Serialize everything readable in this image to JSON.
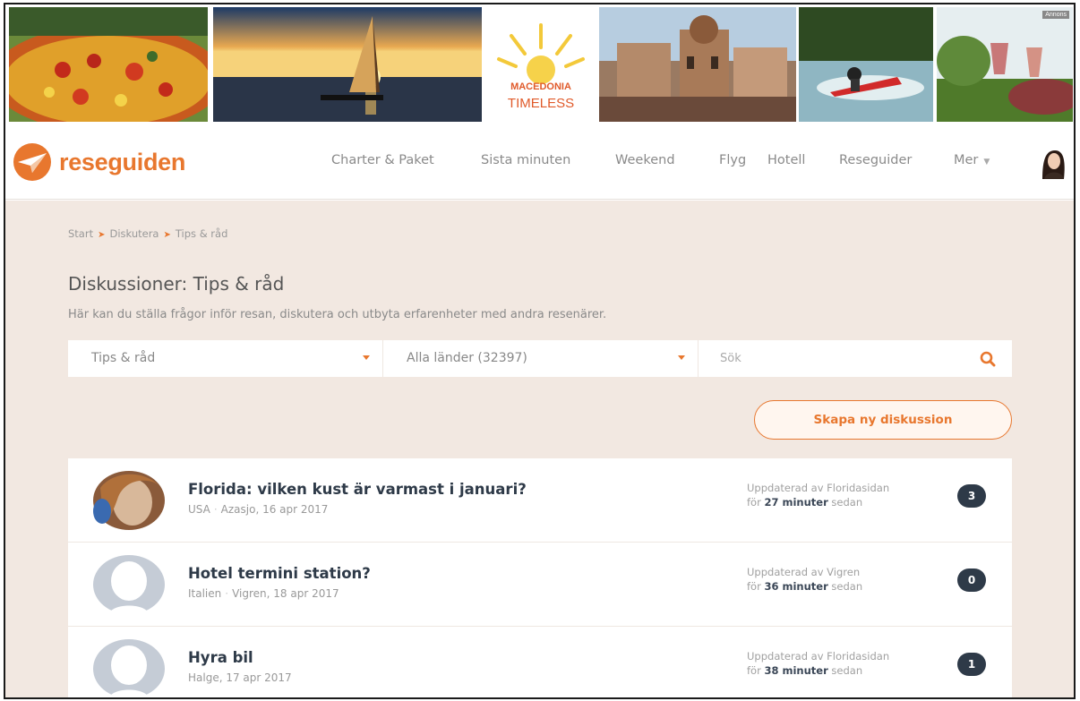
{
  "banner": {
    "ad_label": "Annons",
    "ad_text_line1": "MACEDONIA",
    "ad_text_line2": "TIMELESS"
  },
  "nav": {
    "logo_text": "reseguiden",
    "links": [
      "Charter & Paket",
      "Sista minuten",
      "Weekend",
      "Flyg",
      "Hotell",
      "Reseguider",
      "Mer"
    ]
  },
  "breadcrumb": [
    "Start",
    "Diskutera",
    "Tips & råd"
  ],
  "page": {
    "title": "Diskussioner: Tips & råd",
    "description": "Här kan du ställa frågor inför resan, diskutera och utbyta erfarenheter med andra resenärer."
  },
  "filters": {
    "category": "Tips & råd",
    "country": "Alla länder (32397)",
    "search_placeholder": "Sök"
  },
  "create_button": "Skapa ny diskussion",
  "discussions": [
    {
      "title": "Florida: vilken kust är varmast i januari?",
      "country": "USA",
      "author_date": "Azasjo, 16 apr 2017",
      "updated_by": "Uppdaterad av Floridasidan",
      "ago_prefix": "för",
      "ago_value": "27 minuter",
      "ago_suffix": "sedan",
      "count": "3"
    },
    {
      "title": "Hotel termini station?",
      "country": "Italien",
      "author_date": "Vigren, 18 apr 2017",
      "updated_by": "Uppdaterad av Vigren",
      "ago_prefix": "för",
      "ago_value": "36 minuter",
      "ago_suffix": "sedan",
      "count": "0"
    },
    {
      "title": "Hyra bil",
      "country": "",
      "author_date": "Halge, 17 apr 2017",
      "updated_by": "Uppdaterad av Floridasidan",
      "ago_prefix": "för",
      "ago_value": "38 minuter",
      "ago_suffix": "sedan",
      "count": "1"
    }
  ],
  "colors": {
    "accent": "#e8772e",
    "badge": "#2e3a48",
    "background": "#f2e8e1"
  },
  "icons": {
    "logo": "paper-plane-icon",
    "search": "search-icon",
    "caret": "caret-down-icon"
  }
}
